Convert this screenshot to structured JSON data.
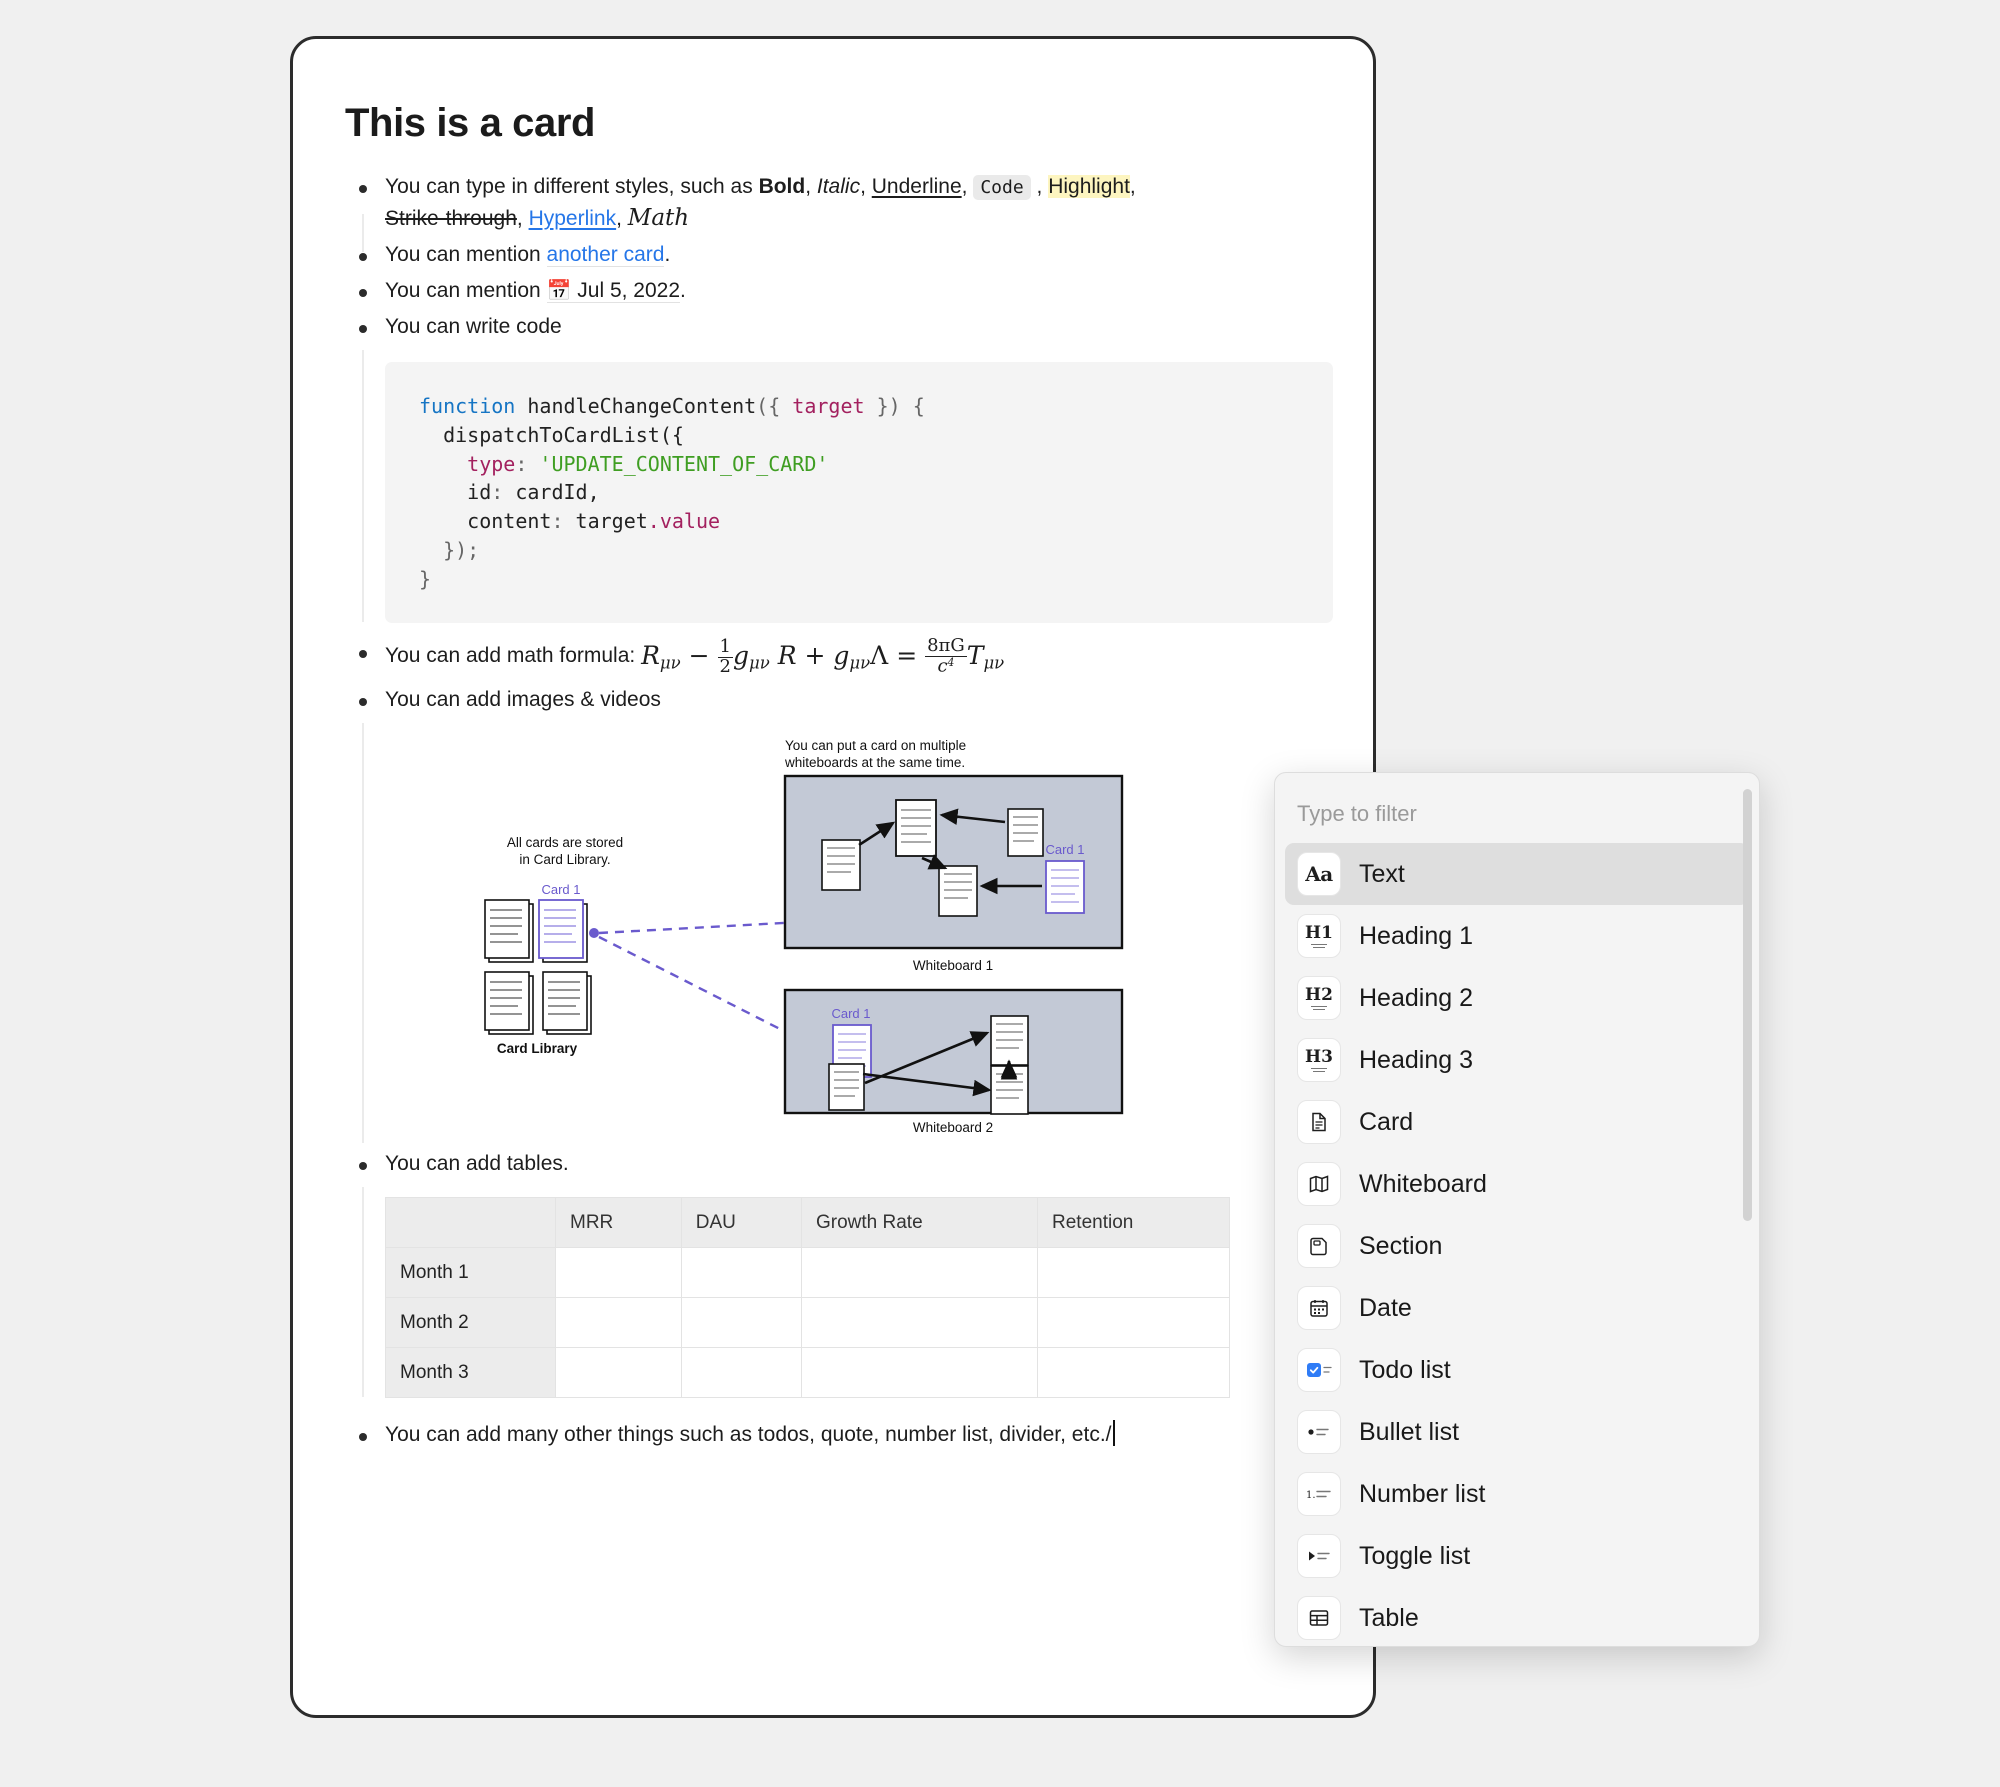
{
  "card": {
    "title": "This is a card",
    "bullets": {
      "styles_line1_prefix": "You can type in different styles, such as ",
      "styles_bold": "Bold",
      "styles_italic": "Italic",
      "styles_underline": "Underline",
      "styles_code": "Code",
      "styles_highlight": "Highlight",
      "styles_strike": "Strike-through",
      "styles_hyperlink": "Hyperlink",
      "styles_math": "Math",
      "mention_card_prefix": "You can mention ",
      "mention_card_link": "another card",
      "mention_card_suffix": ".",
      "mention_date_prefix": "You can mention ",
      "mention_date_icon": "calendar-icon",
      "mention_date_value": "Jul 5, 2022",
      "mention_date_suffix": ".",
      "write_code": "You can write code",
      "math_formula_label": "You can add math formula: ",
      "images_videos": "You can add images & videos",
      "tables": "You can add tables.",
      "other_things": "You can add many other things such as todos, quote, number list, divider, etc./"
    },
    "code": {
      "line1_kw": "function",
      "line1_name": " handleChangeContent",
      "line1_open": "({ ",
      "line1_param": "target",
      "line1_close": " }) {",
      "line2": "  dispatchToCardList({",
      "line3_key": "    type",
      "line3_colon": ": ",
      "line3_val": "'UPDATE_CONTENT_OF_CARD'",
      "line4_key": "    id",
      "line4_colon": ": ",
      "line4_val": "cardId,",
      "line5_key": "    content",
      "line5_colon": ": ",
      "line5_obj": "target",
      "line5_dot": ".",
      "line5_prop": "value",
      "line6": "  });",
      "line7": "}"
    },
    "math": {
      "R": "R",
      "minus": "−",
      "half_num": "1",
      "half_den": "2",
      "g": "g",
      "R2": "R",
      "plus": "+",
      "g2": "g",
      "Lambda": "Λ",
      "equals": "=",
      "frac_num": "8πG",
      "frac_den_c": "c",
      "frac_den_exp": "4",
      "T": "T",
      "mu_nu": "μν"
    },
    "diagram": {
      "caption_top_line1": "You can put a card on multiple",
      "caption_top_line2": "whiteboards at the same time.",
      "caption_left_line1": "All cards are stored",
      "caption_left_line2": "in Card Library.",
      "library_card_label": "Card 1",
      "library_label": "Card Library",
      "wb1_card_label": "Card 1",
      "wb1_label": "Whiteboard 1",
      "wb2_card_label": "Card 1",
      "wb2_label": "Whiteboard 2"
    },
    "table": {
      "headers": [
        "",
        "MRR",
        "DAU",
        "Growth Rate",
        "Retention"
      ],
      "rows": [
        {
          "label": "Month 1",
          "cells": [
            "",
            "",
            "",
            ""
          ]
        },
        {
          "label": "Month 2",
          "cells": [
            "",
            "",
            "",
            ""
          ]
        },
        {
          "label": "Month 3",
          "cells": [
            "",
            "",
            "",
            ""
          ]
        }
      ]
    }
  },
  "slash_menu": {
    "filter_placeholder": "Type to filter",
    "items": [
      {
        "label": "Text",
        "icon": "text-aa-icon",
        "selected": true
      },
      {
        "label": "Heading 1",
        "icon": "heading-1-icon",
        "selected": false
      },
      {
        "label": "Heading 2",
        "icon": "heading-2-icon",
        "selected": false
      },
      {
        "label": "Heading 3",
        "icon": "heading-3-icon",
        "selected": false
      },
      {
        "label": "Card",
        "icon": "document-icon",
        "selected": false
      },
      {
        "label": "Whiteboard",
        "icon": "whiteboard-icon",
        "selected": false
      },
      {
        "label": "Section",
        "icon": "section-icon",
        "selected": false
      },
      {
        "label": "Date",
        "icon": "calendar-icon",
        "selected": false
      },
      {
        "label": "Todo list",
        "icon": "checkbox-icon",
        "selected": false
      },
      {
        "label": "Bullet list",
        "icon": "bullet-list-icon",
        "selected": false
      },
      {
        "label": "Number list",
        "icon": "number-list-icon",
        "selected": false
      },
      {
        "label": "Toggle list",
        "icon": "toggle-list-icon",
        "selected": false
      },
      {
        "label": "Table",
        "icon": "table-icon",
        "selected": false
      }
    ]
  },
  "colors": {
    "page_background": "#f0f0f0",
    "card_border": "#2c2c2c",
    "link": "#2576e8",
    "highlight": "#fdf5c0",
    "code_background": "#f4f4f4",
    "menu_background": "#f4f4f4",
    "menu_selected": "#dedede",
    "accent_purple": "#6a5acd",
    "whiteboard_fill": "#c3c9d6",
    "checkbox_blue": "#2f7cf6"
  }
}
